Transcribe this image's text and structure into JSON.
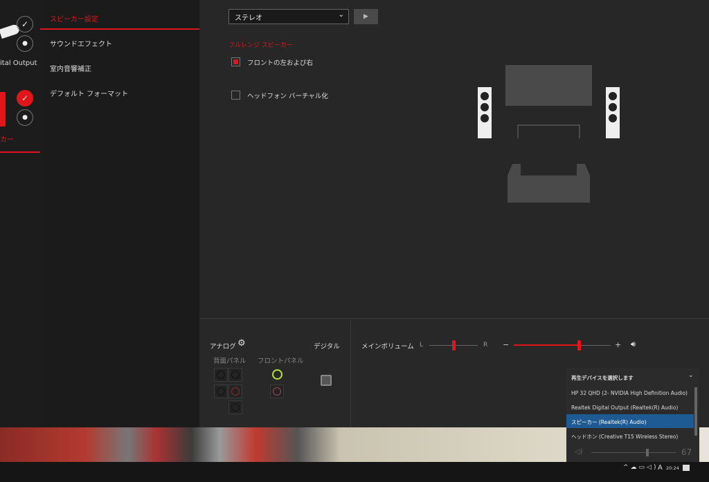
{
  "devices": {
    "digital_label": "ital Output",
    "speaker_label": "カー"
  },
  "nav": {
    "items": [
      {
        "label": "スピーカー設定",
        "active": true
      },
      {
        "label": "サウンドエフェクト"
      },
      {
        "label": "室内音響補正"
      },
      {
        "label": "デフォルト フォーマット"
      }
    ]
  },
  "main": {
    "config_select": "ステレオ",
    "section_title": "フルレンジ スピーカー",
    "options": [
      {
        "label": "フロントの左および右",
        "checked": true
      },
      {
        "label": "ヘッドフォン バーチャル化",
        "checked": false
      }
    ]
  },
  "bottom": {
    "analog_label": "アナログ",
    "rear_panel": "背面パネル",
    "front_panel": "フロントパネル",
    "digital_label": "デジタル",
    "main_volume": "メインボリューム",
    "balance_left": "L",
    "balance_right": "R",
    "minus": "−",
    "plus": "+",
    "balance_value": 0.5,
    "volume_value": 0.67
  },
  "flyout": {
    "title": "再生デバイスを選択します",
    "devices": [
      "HP 32 QHD (2- NVIDIA High Definition Audio)",
      "Realtek Digital Output (Realtek(R) Audio)",
      "スピーカー (Realtek(R) Audio)",
      "ヘッドホン (Creative T15 Wireless Stereo)"
    ],
    "selected_index": 2,
    "volume": "67"
  },
  "taskbar": {
    "time": "20:24",
    "ime": "A"
  },
  "colors": {
    "accent": "#e0161b",
    "selected": "#1e5b94"
  }
}
